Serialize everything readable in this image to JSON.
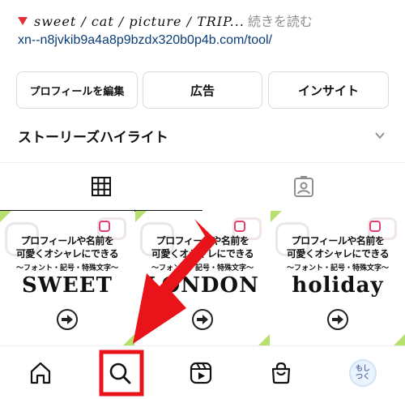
{
  "bio": {
    "bullet_icon": "red-down-triangle",
    "text": "sweet / cat / picture / TRIP...",
    "more_label": "続きを読む",
    "link": "xn--n8jvkib9a4a8p9bzdx320b0p4b.com/tool/"
  },
  "buttons": {
    "edit_profile": "プロフィールを編集",
    "ads": "広告",
    "insights": "インサイト"
  },
  "highlights": {
    "title": "ストーリーズハイライト",
    "chevron_icon": "chevron-down-icon"
  },
  "tabs": [
    {
      "icon": "grid-icon",
      "active": true
    },
    {
      "icon": "tagged-icon",
      "active": false
    }
  ],
  "posts": [
    {
      "line1": "プロフィールや名前を",
      "line2": "可愛くオシャレにできる",
      "line3": "〜フォント・記号・特殊文字〜",
      "title": "SWEET"
    },
    {
      "line1": "プロフィールや名前を",
      "line2": "可愛くオシャレにできる",
      "line3": "〜フォント・記号・特殊文字〜",
      "title": "LONDON"
    },
    {
      "line1": "プロフィールや名前を",
      "line2": "可愛くオシャレにできる",
      "line3": "〜フォント・記号・特殊文字〜",
      "title": "holiday"
    }
  ],
  "nav": {
    "items": [
      "home-icon",
      "search-icon",
      "reels-icon",
      "shop-icon",
      "profile-avatar"
    ],
    "avatar_text": "もし\nつく"
  },
  "annotation": {
    "color": "#e8141a",
    "target": "search-icon"
  },
  "colors": {
    "link": "#0a3d78",
    "accent_red": "#e8141a",
    "post_corner": "#b7e06e"
  }
}
